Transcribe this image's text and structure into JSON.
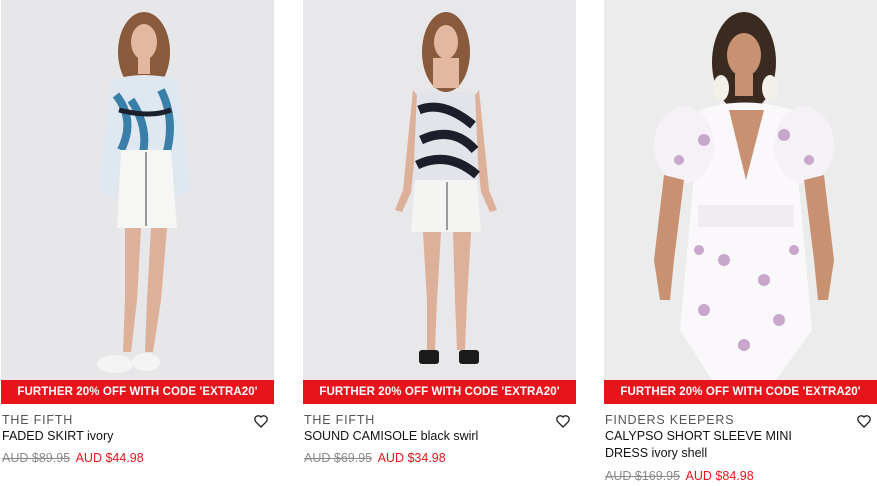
{
  "products": [
    {
      "promo": "FURTHER 20% OFF WITH CODE 'EXTRA20'",
      "brand": "THE FIFTH",
      "name": "FADED SKIRT ivory",
      "old_price": "AUD $89.95",
      "new_price": "AUD $44.98",
      "wishlist_icon": "heart-outline"
    },
    {
      "promo": "FURTHER 20% OFF WITH CODE 'EXTRA20'",
      "brand": "THE FIFTH",
      "name": "SOUND CAMISOLE black swirl",
      "old_price": "AUD $69.95",
      "new_price": "AUD $34.98",
      "wishlist_icon": "heart-outline"
    },
    {
      "promo": "FURTHER 20% OFF WITH CODE 'EXTRA20'",
      "brand": "FINDERS KEEPERS",
      "name": "CALYPSO SHORT SLEEVE MINI DRESS ivory shell",
      "old_price": "AUD $169.95",
      "new_price": "AUD $84.98",
      "wishlist_icon": "heart-outline"
    }
  ],
  "colors": {
    "promo_bg": "#e8141b",
    "sale_price": "#e8141b",
    "old_price": "#8a8a8a"
  }
}
